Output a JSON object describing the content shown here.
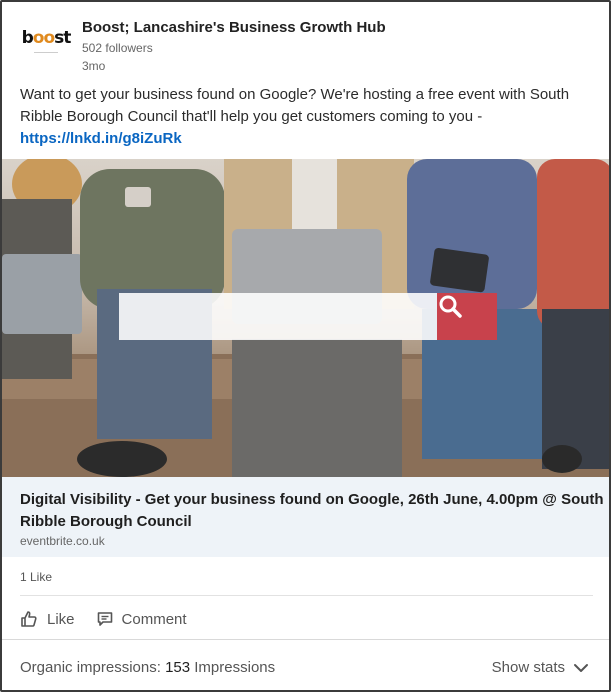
{
  "organization": {
    "logo_text": "boost",
    "logo_tagline": "business lancashire",
    "name": "Boost; Lancashire's Business Growth Hub",
    "followers": "502 followers",
    "age": "3mo"
  },
  "post": {
    "text": "Want to get your business found on Google? We're hosting a free event with South Ribble Borough Council that'll help you get customers coming to you -",
    "link": "https://lnkd.in/g8iZuRk"
  },
  "link_preview": {
    "title": "Digital Visibility - Get your business found on Google, 26th June, 4.00pm @ South Ribble Borough Council",
    "domain": "eventbrite.co.uk"
  },
  "reactions": {
    "likes": "1 Like"
  },
  "actions": {
    "like_label": "Like",
    "comment_label": "Comment"
  },
  "footer": {
    "impressions_label": "Organic impressions:",
    "impressions_count": "153",
    "impressions_unit": "Impressions",
    "show_stats_label": "Show stats"
  },
  "colors": {
    "link": "#0a66c2",
    "search_button": "#c8424c",
    "logo_accent": "#e08a1e"
  },
  "icons": [
    "search-icon",
    "thumbs-up-icon",
    "comment-icon",
    "chevron-down-icon"
  ]
}
